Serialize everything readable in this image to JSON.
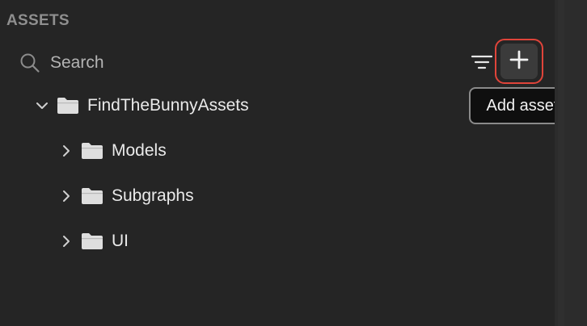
{
  "panel": {
    "title": "ASSETS"
  },
  "search": {
    "label": "Search",
    "icon": "search-icon"
  },
  "toolbar": {
    "filter_icon": "filter-icon",
    "add_icon": "plus-icon",
    "add_tooltip": "Add asset"
  },
  "tree": {
    "root": {
      "label": "FindTheBunnyAssets",
      "expanded": true
    },
    "children": [
      {
        "label": "Models",
        "expanded": false
      },
      {
        "label": "Subgraphs",
        "expanded": false
      },
      {
        "label": "UI",
        "expanded": false
      }
    ]
  },
  "colors": {
    "background": "#252525",
    "highlight_border": "#e0443a",
    "text": "#eaeaea",
    "muted_text": "#8f8f8f"
  }
}
